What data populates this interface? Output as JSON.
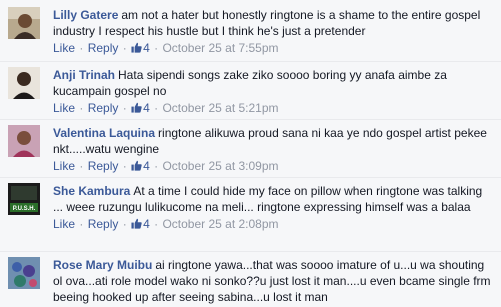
{
  "actions": {
    "like": "Like",
    "reply": "Reply",
    "dot": "·"
  },
  "colors": {
    "link": "#3b5998",
    "meta": "#9197a3",
    "text": "#141823",
    "bg": "#f6f7f9"
  },
  "comments": [
    {
      "author": "Lilly Gatere",
      "text": "am not a hater but honestly ringtone is a shame to the entire gospel industry I respect his hustle but I think he's just a pretender",
      "likes": "4",
      "timestamp": "October 25 at 7:55pm",
      "avatar_icon": "profile-photo-woman"
    },
    {
      "author": "Anji Trinah",
      "text": "Hata sipendi songs zake ziko soooo boring yy anafa aimbe za kucampain gospel no",
      "likes": "4",
      "timestamp": "October 25 at 5:21pm",
      "avatar_icon": "profile-photo-woman"
    },
    {
      "author": "Valentina Laquina",
      "text": "ringtone alikuwa proud sana ni kaa ye ndo gospel artist pekee nkt.....watu wengine",
      "likes": "4",
      "timestamp": "October 25 at 3:09pm",
      "avatar_icon": "profile-photo-woman"
    },
    {
      "author": "She Kambura",
      "text": "At a time I could hide my face on pillow when ringtone was talking ... weee ruzungu lulikucome na meli... ringtone expressing himself was a balaa",
      "likes": "4",
      "timestamp": "October 25 at 2:08pm",
      "avatar_icon": "push-logo",
      "avatar_label": "P.U.S.H."
    },
    {
      "author": "Rose Mary Muibu",
      "text": "ai ringtone yawa...that was soooo imature of u...u wa shouting ol ova...ati role model wako ni sonko??u just lost it man....u even bcame single frm beeing hooked up after seeing sabina...u lost it man",
      "likes": "",
      "timestamp": "",
      "avatar_icon": "profile-photo-flowers"
    }
  ]
}
